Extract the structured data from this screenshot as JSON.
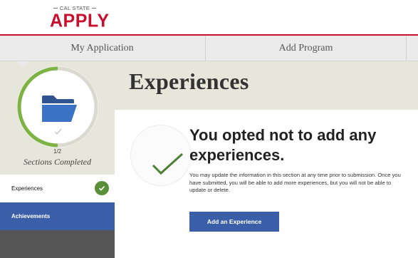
{
  "brand": {
    "top_line": "CAL STATE",
    "name": "APPLY",
    "accent_color": "#c8102e"
  },
  "nav": {
    "tabs": [
      {
        "label": "My Application"
      },
      {
        "label": "Add Program"
      },
      {
        "label": ""
      }
    ]
  },
  "sidebar": {
    "progress": {
      "completed": 1,
      "total": 2,
      "count_text": "1/2",
      "label": "Sections Completed",
      "fraction": 0.5,
      "ring_color": "#7cb342"
    },
    "folder_icon": "folder-icon",
    "items": [
      {
        "label": "Experiences",
        "status": "completed",
        "status_icon": "check-icon"
      },
      {
        "label": "Achievements",
        "status": "selected"
      }
    ]
  },
  "main": {
    "title": "Experiences",
    "headline": "You opted not to add any experiences.",
    "description": "You may update the information in this section at any time prior to submission. Once you have submitted, you will be able to add more experiences, but you will not be able to update or delete.",
    "add_button_label": "Add an Experience",
    "button_color": "#3a5fa8",
    "check_color": "#4a7f34"
  }
}
